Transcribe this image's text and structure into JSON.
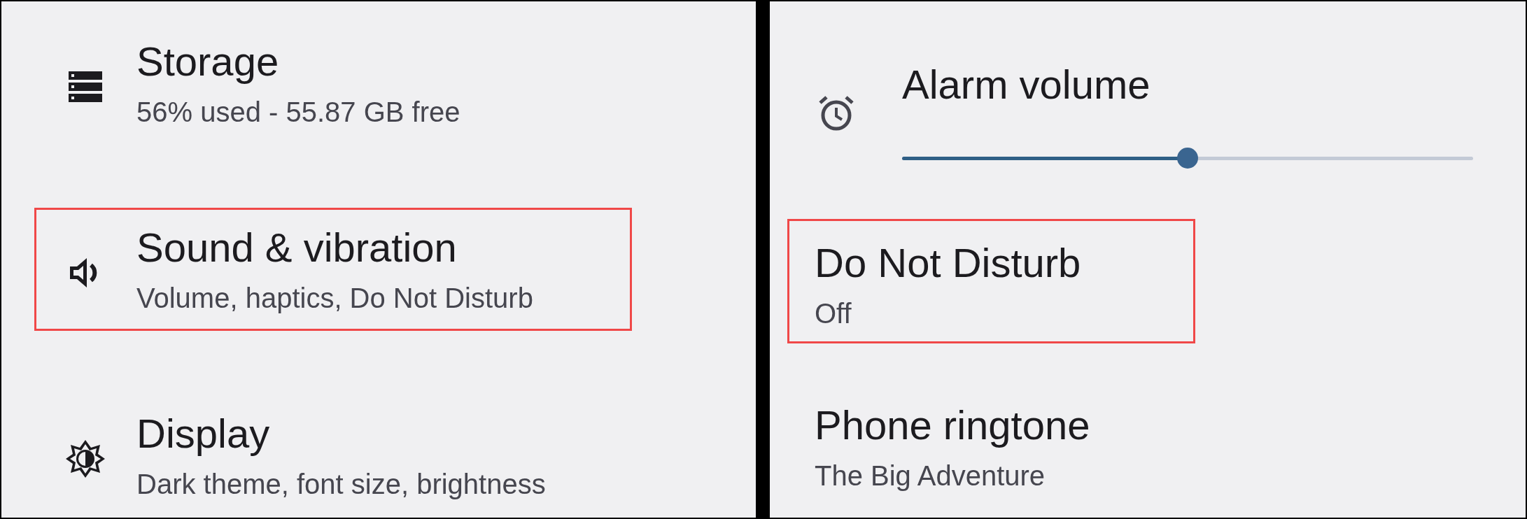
{
  "left_panel": {
    "items": [
      {
        "title": "Storage",
        "subtitle": "56% used - 55.87 GB free",
        "highlighted": false
      },
      {
        "title": "Sound & vibration",
        "subtitle": "Volume, haptics, Do Not Disturb",
        "highlighted": true
      },
      {
        "title": "Display",
        "subtitle": "Dark theme, font size, brightness",
        "highlighted": false
      }
    ]
  },
  "right_panel": {
    "items": [
      {
        "kind": "slider",
        "title": "Alarm volume",
        "level": 0.5
      },
      {
        "kind": "entry",
        "title": "Do Not Disturb",
        "subtitle": "Off",
        "highlighted": true
      },
      {
        "kind": "entry",
        "title": "Phone ringtone",
        "subtitle": "The Big Adventure",
        "highlighted": false
      }
    ]
  }
}
